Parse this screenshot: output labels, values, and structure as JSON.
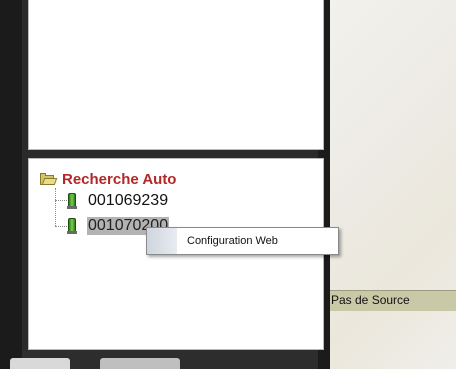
{
  "tree": {
    "root_label": "Recherche Auto",
    "items": [
      {
        "label": "001069239"
      },
      {
        "label": "001070200"
      }
    ]
  },
  "context_menu": {
    "items": [
      {
        "label": "Configuration Web"
      }
    ]
  },
  "status_bar": {
    "text": "Pas de Source"
  },
  "colors": {
    "root_label": "#b22828",
    "status_bar": "#c9c8a7",
    "selection": "#b3b3b3"
  }
}
